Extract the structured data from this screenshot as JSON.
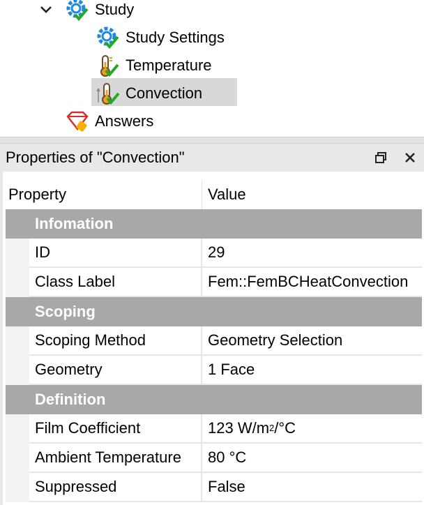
{
  "tree": {
    "items": [
      {
        "label": "Study",
        "icon": "study-gear-icon",
        "expanded": true
      },
      {
        "label": "Study Settings",
        "icon": "gear-check-icon"
      },
      {
        "label": "Temperature",
        "icon": "thermometer-check-icon"
      },
      {
        "label": "Convection",
        "icon": "convection-check-icon",
        "selected": true
      },
      {
        "label": "Answers",
        "icon": "answers-gem-icon"
      }
    ]
  },
  "panel": {
    "title": "Properties of \"Convection\""
  },
  "grid": {
    "headers": {
      "property": "Property",
      "value": "Value"
    },
    "groups": [
      {
        "name": "Infomation",
        "rows": [
          {
            "property": "ID",
            "value": "29"
          },
          {
            "property": "Class Label",
            "value": "Fem::FemBCHeatConvection"
          }
        ]
      },
      {
        "name": "Scoping",
        "rows": [
          {
            "property": "Scoping Method",
            "value": "Geometry Selection"
          },
          {
            "property": "Geometry",
            "value": "1 Face"
          }
        ]
      },
      {
        "name": "Definition",
        "rows": [
          {
            "property": "Film Coefficient",
            "value_pre": "123 W/m",
            "value_sup": "2",
            "value_post": "/°C"
          },
          {
            "property": "Ambient Temperature",
            "value": "80 °C"
          },
          {
            "property": "Suppressed",
            "value": "False"
          }
        ]
      }
    ]
  },
  "colors": {
    "group_bg": "#a8a8a8",
    "selected_bg": "#d8d8d8",
    "check_green": "#22aa22",
    "gear_blue": "#1e88e5"
  }
}
